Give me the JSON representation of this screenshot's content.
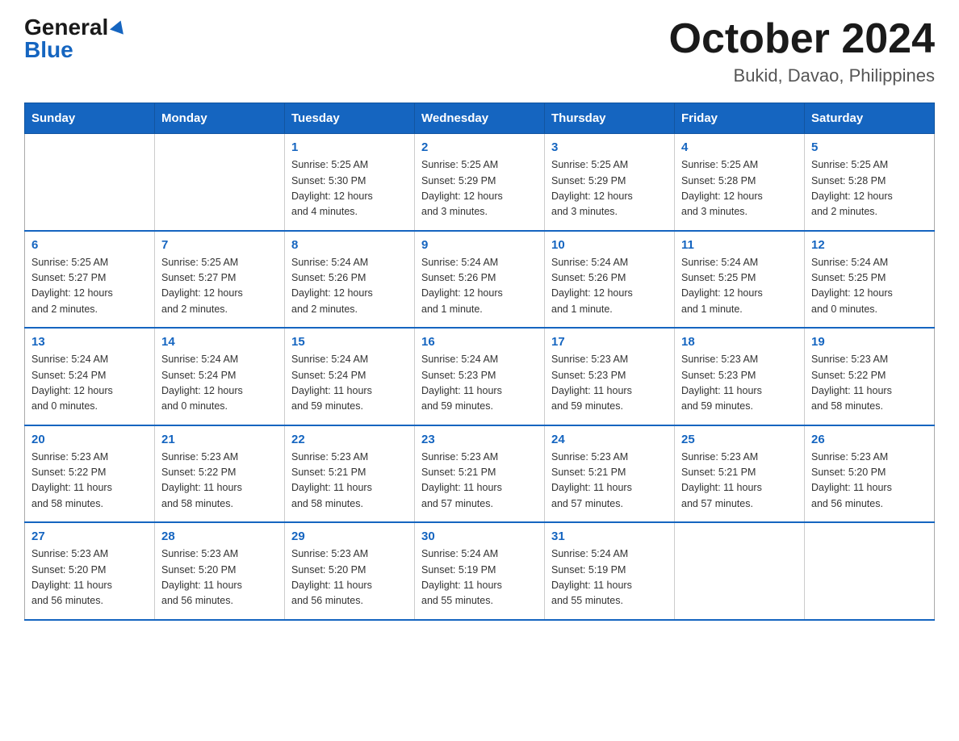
{
  "header": {
    "logo": {
      "general": "General",
      "blue": "Blue"
    },
    "title": "October 2024",
    "location": "Bukid, Davao, Philippines"
  },
  "calendar": {
    "weekdays": [
      "Sunday",
      "Monday",
      "Tuesday",
      "Wednesday",
      "Thursday",
      "Friday",
      "Saturday"
    ],
    "weeks": [
      [
        {
          "day": "",
          "info": ""
        },
        {
          "day": "",
          "info": ""
        },
        {
          "day": "1",
          "info": "Sunrise: 5:25 AM\nSunset: 5:30 PM\nDaylight: 12 hours\nand 4 minutes."
        },
        {
          "day": "2",
          "info": "Sunrise: 5:25 AM\nSunset: 5:29 PM\nDaylight: 12 hours\nand 3 minutes."
        },
        {
          "day": "3",
          "info": "Sunrise: 5:25 AM\nSunset: 5:29 PM\nDaylight: 12 hours\nand 3 minutes."
        },
        {
          "day": "4",
          "info": "Sunrise: 5:25 AM\nSunset: 5:28 PM\nDaylight: 12 hours\nand 3 minutes."
        },
        {
          "day": "5",
          "info": "Sunrise: 5:25 AM\nSunset: 5:28 PM\nDaylight: 12 hours\nand 2 minutes."
        }
      ],
      [
        {
          "day": "6",
          "info": "Sunrise: 5:25 AM\nSunset: 5:27 PM\nDaylight: 12 hours\nand 2 minutes."
        },
        {
          "day": "7",
          "info": "Sunrise: 5:25 AM\nSunset: 5:27 PM\nDaylight: 12 hours\nand 2 minutes."
        },
        {
          "day": "8",
          "info": "Sunrise: 5:24 AM\nSunset: 5:26 PM\nDaylight: 12 hours\nand 2 minutes."
        },
        {
          "day": "9",
          "info": "Sunrise: 5:24 AM\nSunset: 5:26 PM\nDaylight: 12 hours\nand 1 minute."
        },
        {
          "day": "10",
          "info": "Sunrise: 5:24 AM\nSunset: 5:26 PM\nDaylight: 12 hours\nand 1 minute."
        },
        {
          "day": "11",
          "info": "Sunrise: 5:24 AM\nSunset: 5:25 PM\nDaylight: 12 hours\nand 1 minute."
        },
        {
          "day": "12",
          "info": "Sunrise: 5:24 AM\nSunset: 5:25 PM\nDaylight: 12 hours\nand 0 minutes."
        }
      ],
      [
        {
          "day": "13",
          "info": "Sunrise: 5:24 AM\nSunset: 5:24 PM\nDaylight: 12 hours\nand 0 minutes."
        },
        {
          "day": "14",
          "info": "Sunrise: 5:24 AM\nSunset: 5:24 PM\nDaylight: 12 hours\nand 0 minutes."
        },
        {
          "day": "15",
          "info": "Sunrise: 5:24 AM\nSunset: 5:24 PM\nDaylight: 11 hours\nand 59 minutes."
        },
        {
          "day": "16",
          "info": "Sunrise: 5:24 AM\nSunset: 5:23 PM\nDaylight: 11 hours\nand 59 minutes."
        },
        {
          "day": "17",
          "info": "Sunrise: 5:23 AM\nSunset: 5:23 PM\nDaylight: 11 hours\nand 59 minutes."
        },
        {
          "day": "18",
          "info": "Sunrise: 5:23 AM\nSunset: 5:23 PM\nDaylight: 11 hours\nand 59 minutes."
        },
        {
          "day": "19",
          "info": "Sunrise: 5:23 AM\nSunset: 5:22 PM\nDaylight: 11 hours\nand 58 minutes."
        }
      ],
      [
        {
          "day": "20",
          "info": "Sunrise: 5:23 AM\nSunset: 5:22 PM\nDaylight: 11 hours\nand 58 minutes."
        },
        {
          "day": "21",
          "info": "Sunrise: 5:23 AM\nSunset: 5:22 PM\nDaylight: 11 hours\nand 58 minutes."
        },
        {
          "day": "22",
          "info": "Sunrise: 5:23 AM\nSunset: 5:21 PM\nDaylight: 11 hours\nand 58 minutes."
        },
        {
          "day": "23",
          "info": "Sunrise: 5:23 AM\nSunset: 5:21 PM\nDaylight: 11 hours\nand 57 minutes."
        },
        {
          "day": "24",
          "info": "Sunrise: 5:23 AM\nSunset: 5:21 PM\nDaylight: 11 hours\nand 57 minutes."
        },
        {
          "day": "25",
          "info": "Sunrise: 5:23 AM\nSunset: 5:21 PM\nDaylight: 11 hours\nand 57 minutes."
        },
        {
          "day": "26",
          "info": "Sunrise: 5:23 AM\nSunset: 5:20 PM\nDaylight: 11 hours\nand 56 minutes."
        }
      ],
      [
        {
          "day": "27",
          "info": "Sunrise: 5:23 AM\nSunset: 5:20 PM\nDaylight: 11 hours\nand 56 minutes."
        },
        {
          "day": "28",
          "info": "Sunrise: 5:23 AM\nSunset: 5:20 PM\nDaylight: 11 hours\nand 56 minutes."
        },
        {
          "day": "29",
          "info": "Sunrise: 5:23 AM\nSunset: 5:20 PM\nDaylight: 11 hours\nand 56 minutes."
        },
        {
          "day": "30",
          "info": "Sunrise: 5:24 AM\nSunset: 5:19 PM\nDaylight: 11 hours\nand 55 minutes."
        },
        {
          "day": "31",
          "info": "Sunrise: 5:24 AM\nSunset: 5:19 PM\nDaylight: 11 hours\nand 55 minutes."
        },
        {
          "day": "",
          "info": ""
        },
        {
          "day": "",
          "info": ""
        }
      ]
    ]
  }
}
